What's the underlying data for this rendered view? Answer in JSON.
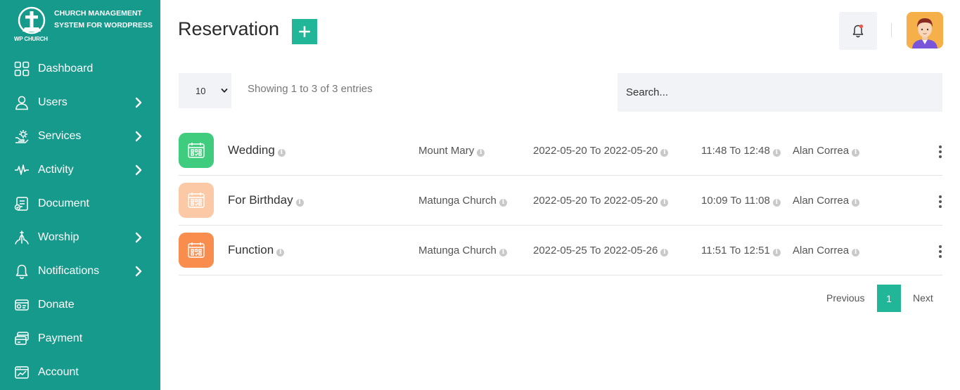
{
  "brand": {
    "logo_text": "WP CHURCH",
    "title": "CHURCH MANAGEMENT SYSTEM FOR WORDPRESS"
  },
  "sidebar": {
    "items": [
      {
        "label": "Dashboard",
        "icon": "grid-icon",
        "has_submenu": false
      },
      {
        "label": "Users",
        "icon": "user-icon",
        "has_submenu": true
      },
      {
        "label": "Services",
        "icon": "settings-hand-icon",
        "has_submenu": true
      },
      {
        "label": "Activity",
        "icon": "pulse-icon",
        "has_submenu": true
      },
      {
        "label": "Document",
        "icon": "document-icon",
        "has_submenu": false
      },
      {
        "label": "Worship",
        "icon": "worship-icon",
        "has_submenu": true
      },
      {
        "label": "Notifications",
        "icon": "bell-icon",
        "has_submenu": true
      },
      {
        "label": "Donate",
        "icon": "donate-icon",
        "has_submenu": false
      },
      {
        "label": "Payment",
        "icon": "payment-icon",
        "has_submenu": false
      },
      {
        "label": "Account",
        "icon": "account-icon",
        "has_submenu": false
      }
    ]
  },
  "header": {
    "title": "Reservation",
    "add_label": "+"
  },
  "controls": {
    "page_length": "10",
    "entries_info": "Showing 1 to 3 of 3 entries",
    "search_placeholder": "Search..."
  },
  "reservations": [
    {
      "title": "Wedding",
      "location": "Mount Mary",
      "dates": "2022-05-20 To 2022-05-20",
      "time": "11:48 To 12:48",
      "person": "Alan Correa",
      "icon_bg": "#3fcc7e"
    },
    {
      "title": "For Birthday",
      "location": "Matunga Church",
      "dates": "2022-05-20 To 2022-05-20",
      "time": "10:09 To 11:08",
      "person": "Alan Correa",
      "icon_bg": "#fbc9a6"
    },
    {
      "title": "Function",
      "location": "Matunga Church",
      "dates": "2022-05-25 To 2022-05-26",
      "time": "11:51 To 12:51",
      "person": "Alan Correa",
      "icon_bg": "#f98d4e"
    }
  ],
  "pagination": {
    "previous": "Previous",
    "current": "1",
    "next": "Next"
  },
  "colors": {
    "sidebar": "#159a8c",
    "accent": "#20b697",
    "notification_dot": "#e8584a"
  }
}
